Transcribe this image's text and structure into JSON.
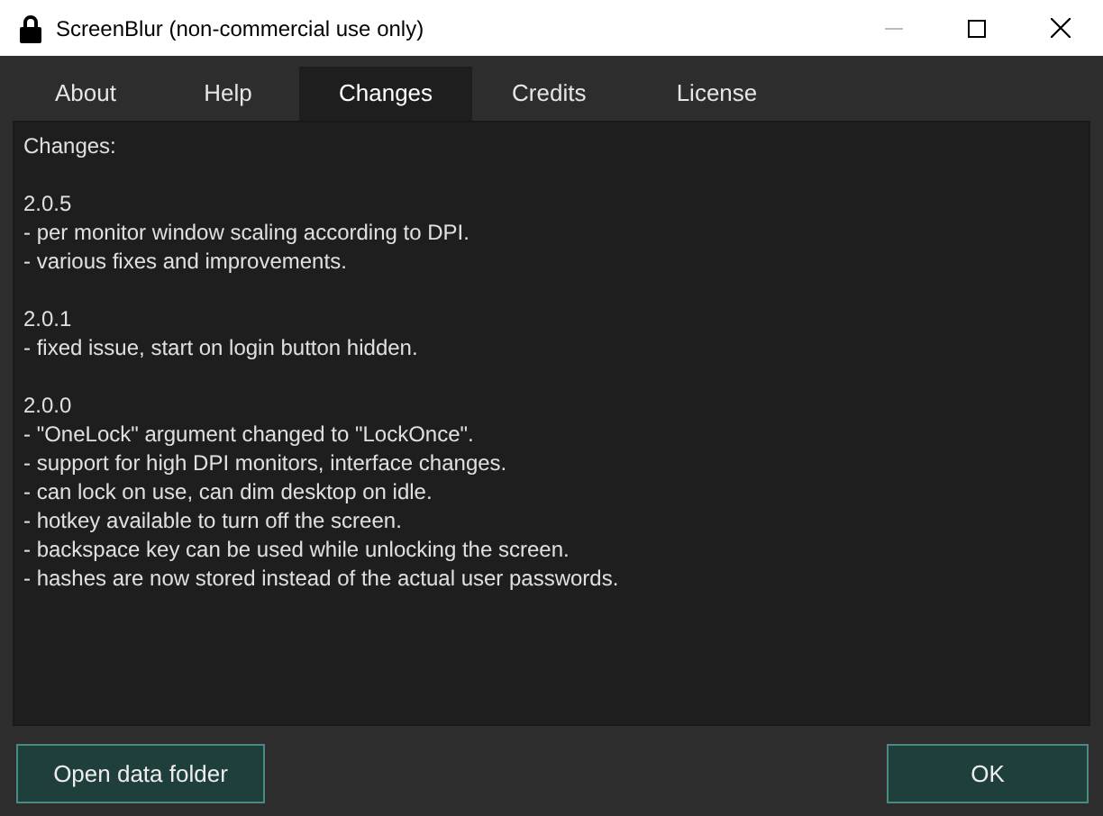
{
  "window": {
    "title": "ScreenBlur (non-commercial use only)"
  },
  "tabs": [
    {
      "label": "About",
      "selected": false
    },
    {
      "label": "Help",
      "selected": false
    },
    {
      "label": "Changes",
      "selected": true
    },
    {
      "label": "Credits",
      "selected": false
    },
    {
      "label": "License",
      "selected": false
    }
  ],
  "content": {
    "heading": "Changes:",
    "versions": [
      {
        "version": "2.0.5",
        "items": [
          "- per monitor window scaling according to DPI.",
          "- various fixes and improvements."
        ]
      },
      {
        "version": "2.0.1",
        "items": [
          "- fixed issue, start on login button hidden."
        ]
      },
      {
        "version": "2.0.0",
        "items": [
          "- \"OneLock\" argument changed to \"LockOnce\".",
          "- support for high DPI monitors, interface changes.",
          "- can lock on use, can dim desktop on idle.",
          "- hotkey available to turn off the screen.",
          "- backspace key can be used while unlocking the screen.",
          "- hashes are now stored instead of the actual user passwords."
        ]
      }
    ]
  },
  "buttons": [
    {
      "label": "Open data folder"
    },
    {
      "label": "OK"
    }
  ]
}
